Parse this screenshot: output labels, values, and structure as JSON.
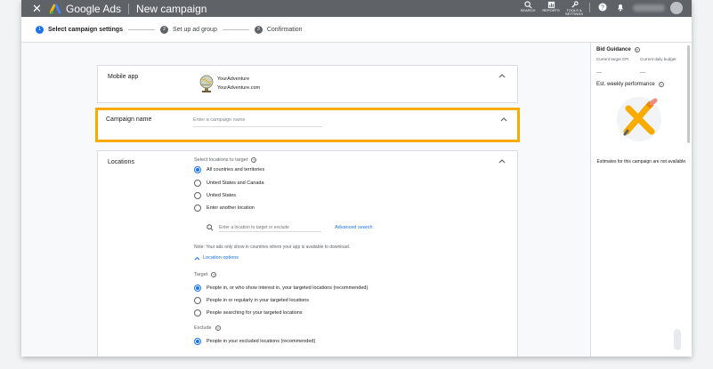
{
  "header": {
    "brand": "Google Ads",
    "page_title": "New campaign",
    "tools": [
      {
        "label": "SEARCH",
        "icon": "search-icon"
      },
      {
        "label": "REPORTS",
        "icon": "reports-icon"
      },
      {
        "label": "TOOLS & SETTINGS",
        "icon": "wrench-icon"
      }
    ]
  },
  "stepper": {
    "steps": [
      {
        "num": "1",
        "label": "Select campaign settings"
      },
      {
        "num": "2",
        "label": "Set up ad group"
      },
      {
        "num": "3",
        "label": "Confirmation"
      }
    ]
  },
  "mobile_app": {
    "title": "Mobile app",
    "app_name": "YourAdventure",
    "app_domain": "YourAdventure.com"
  },
  "campaign_name": {
    "title": "Campaign name",
    "placeholder": "Enter a campaign name"
  },
  "locations": {
    "title": "Locations",
    "select_label": "Select locations to target",
    "options": [
      "All countries and territories",
      "United States and Canada",
      "United States",
      "Enter another location"
    ],
    "selected_option": "All countries and territories",
    "search_placeholder": "Enter a location to target or exclude",
    "advanced_search": "Advanced search",
    "note": "Note: Your ads only show in countries where your app is available to download.",
    "location_options": "Location options",
    "target_label": "Target",
    "target_options": [
      "People in, or who show interest in, your targeted locations (recommended)",
      "People in or regularly in your targeted locations",
      "People searching for your targeted locations"
    ],
    "exclude_label": "Exclude",
    "exclude_options": [
      "People in your excluded locations (recommended)"
    ]
  },
  "side_panel": {
    "heading": "Bid Guidance",
    "metrics": [
      {
        "label": "Current target CPI",
        "value": "—"
      },
      {
        "label": "Current daily budget",
        "value": "—"
      }
    ],
    "performance_title": "Est. weekly performance",
    "estimate_note": "Estimates for this campaign are not available."
  },
  "colors": {
    "topbar": "#5f6368",
    "accent": "#1a73e8",
    "highlight": "#f9ab00"
  }
}
